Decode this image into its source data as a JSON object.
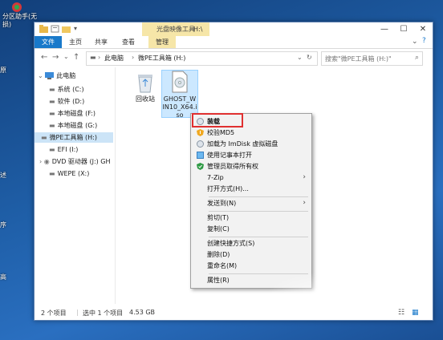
{
  "desktop": {
    "icon_label": "分区助手(无损)",
    "edge_labels": [
      "原",
      "述",
      "序",
      "高"
    ]
  },
  "window": {
    "contextual_tab": "光盘映像工具",
    "title": "H:\\",
    "tabs": [
      "文件",
      "主页",
      "共享",
      "查看",
      "管理"
    ],
    "controls": {
      "minimize": "—",
      "maximize": "☐",
      "close": "✕"
    },
    "breadcrumb": [
      "此电脑",
      "微PE工具箱 (H:)"
    ],
    "search_placeholder": "搜索\"微PE工具箱 (H:)\"",
    "nav_items": [
      {
        "label": "此电脑",
        "icon": "computer-icon"
      },
      {
        "label": "系统 (C:)",
        "icon": "drive-icon"
      },
      {
        "label": "软件 (D:)",
        "icon": "drive-icon"
      },
      {
        "label": "本地磁盘 (F:)",
        "icon": "drive-icon"
      },
      {
        "label": "本地磁盘 (G:)",
        "icon": "drive-icon"
      },
      {
        "label": "微PE工具箱 (H:)",
        "icon": "drive-icon",
        "selected": true
      },
      {
        "label": "EFI (I:)",
        "icon": "drive-icon"
      },
      {
        "label": "DVD 驱动器 (J:) GH",
        "icon": "dvd-icon"
      },
      {
        "label": "WEPE (X:)",
        "icon": "drive-icon"
      }
    ],
    "files": [
      {
        "name": "回收站",
        "icon": "recycle-bin-icon"
      },
      {
        "name_lines": [
          "GHOST_W",
          "IN10_X64.i",
          "so"
        ],
        "icon": "iso-file-icon",
        "selected": true
      }
    ],
    "status": {
      "count": "2 个项目",
      "selected": "选中 1 个项目",
      "size": "4.53 GB"
    }
  },
  "context_menu": [
    {
      "label": "装载",
      "icon": "disc-icon",
      "bold": true,
      "highlighted": true
    },
    {
      "label": "校验MD5",
      "icon": "shield-warning-icon"
    },
    {
      "label": "加载为 ImDisk 虚拟磁盘",
      "icon": "disc-icon"
    },
    {
      "label": "使用记事本打开",
      "icon": "notepad-icon"
    },
    {
      "label": "管理员取得所有权",
      "icon": "shield-check-icon"
    },
    {
      "label": "7-Zip",
      "submenu": true
    },
    {
      "label": "打开方式(H)..."
    },
    {
      "label": "发送到(N)",
      "submenu": true
    },
    {
      "label": "剪切(T)"
    },
    {
      "label": "复制(C)"
    },
    {
      "label": "创建快捷方式(S)"
    },
    {
      "label": "删除(D)"
    },
    {
      "label": "重命名(M)"
    },
    {
      "label": "属性(R)"
    }
  ],
  "colors": {
    "file_tab": "#1979ca",
    "contextual": "#f6e6a8",
    "highlight_box": "#e03030",
    "selection": "#cce4f7"
  }
}
